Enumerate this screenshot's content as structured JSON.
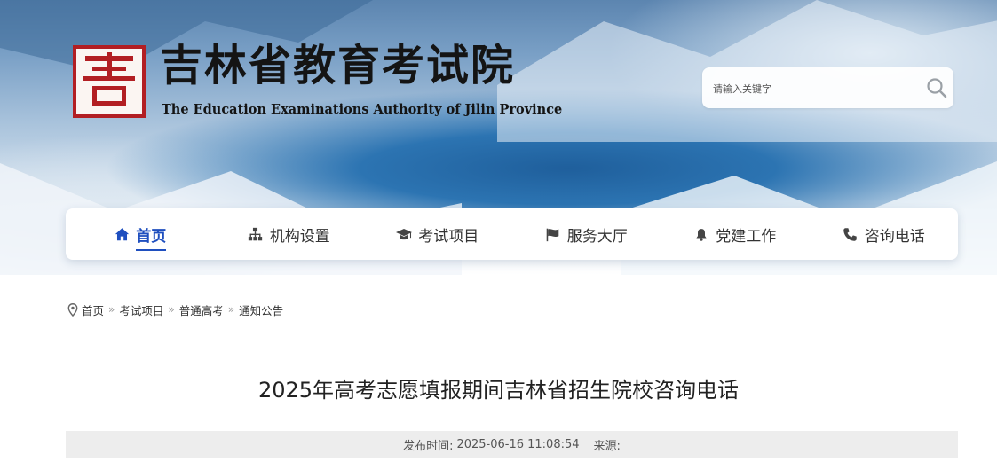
{
  "header": {
    "title": "吉林省教育考试院",
    "subtitle": "The Education Examinations Authority of Jilin Province"
  },
  "search": {
    "placeholder": "请输入关键字",
    "icon": "search-icon"
  },
  "nav": {
    "accent_color": "#1f4fbf",
    "items": [
      {
        "label": "首页",
        "icon": "home-icon",
        "active": true
      },
      {
        "label": "机构设置",
        "icon": "sitemap-icon",
        "active": false
      },
      {
        "label": "考试项目",
        "icon": "graduation-cap-icon",
        "active": false
      },
      {
        "label": "服务大厅",
        "icon": "flag-icon",
        "active": false
      },
      {
        "label": "党建工作",
        "icon": "bell-icon",
        "active": false
      },
      {
        "label": "咨询电话",
        "icon": "phone-icon",
        "active": false
      }
    ]
  },
  "breadcrumb": {
    "icon": "location-pin-icon",
    "items": [
      "首页",
      "考试项目",
      "普通高考",
      "通知公告"
    ]
  },
  "article": {
    "title": "2025年高考志愿填报期间吉林省招生院校咨询电话",
    "publish_label": "发布时间:",
    "publish_time": "2025-06-16 11:08:54",
    "source_label": "来源:",
    "source_value": ""
  },
  "colors": {
    "logo_red": "#b21e23",
    "text_dark": "#141414"
  }
}
